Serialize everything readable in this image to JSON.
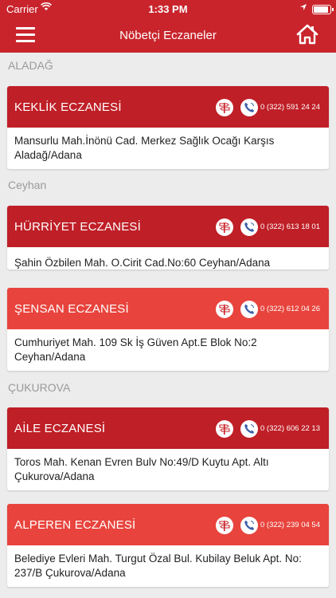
{
  "status_bar": {
    "carrier": "Carrier",
    "time": "1:33 PM"
  },
  "header": {
    "title": "Nöbetçi Eczaneler"
  },
  "sections": [
    {
      "name": "ALADAĞ"
    },
    {
      "name": "Ceyhan"
    },
    {
      "name": "ÇUKUROVA"
    }
  ],
  "pharmacies": [
    {
      "name": "KEKLİK ECZANESİ",
      "phone": "0 (322) 591 24 24",
      "address": "Mansurlu Mah.İnönü Cad. Merkez Sağlık Ocağı Karşıs Aladağ/Adana"
    },
    {
      "name": "HÜRRİYET ECZANESİ",
      "phone": "0 (322) 613 18 01",
      "address": "Şahin Özbilen Mah. O.Cirit Cad.No:60  Ceyhan/Adana"
    },
    {
      "name": "ŞENSAN ECZANESİ",
      "phone": "0 (322) 612 04 26",
      "address": "Cumhuriyet Mah. 109 Sk İş Güven Apt.E Blok No:2 Ceyhan/Adana"
    },
    {
      "name": "AİLE ECZANESİ",
      "phone": "0 (322) 606 22 13",
      "address": "Toros Mah. Kenan Evren Bulv No:49/D Kuytu Apt. Altı Çukurova/Adana"
    },
    {
      "name": "ALPEREN ECZANESİ",
      "phone": "0 (322) 239 04 54",
      "address": "Belediye Evleri Mah. Turgut Özal Bul. Kubilay Beluk Apt. No: 237/B  Çukurova/Adana"
    }
  ],
  "colors": {
    "header": "#c9242c",
    "card_dark": "#bf1f27",
    "card_light": "#e8443d",
    "section_text": "#9a9a9a"
  },
  "icons": {
    "menu": "hamburger-icon",
    "home": "home-icon",
    "map": "map-signpost-icon",
    "phone": "phone-icon"
  }
}
